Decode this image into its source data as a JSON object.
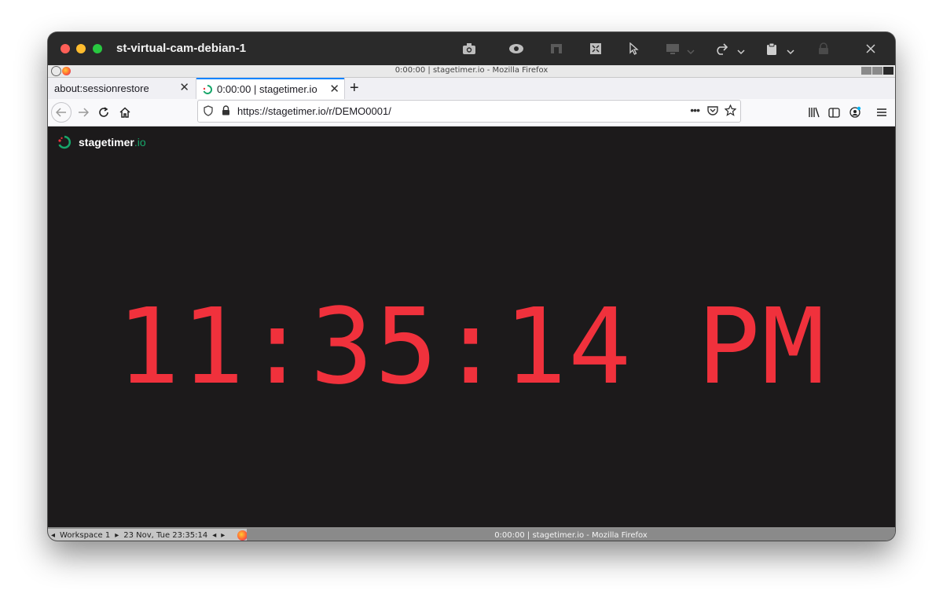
{
  "window": {
    "title": "st-virtual-cam-debian-1"
  },
  "toolbar_icons": [
    "camera-icon",
    "eye-icon",
    "dock-icon",
    "fit-icon",
    "pointer-icon",
    "display-icon",
    "redo-icon",
    "clipboard-icon",
    "lock-icon",
    "close-icon"
  ],
  "x11_bar": {
    "title": "0:00:00 | stagetimer.io - Mozilla Firefox"
  },
  "tabs": [
    {
      "label": "about:sessionrestore",
      "active": false
    },
    {
      "label": "0:00:00 | stagetimer.io",
      "active": true
    }
  ],
  "url": "https://stagetimer.io/r/DEMO0001/",
  "logo": {
    "name": "stagetimer",
    "suffix": ".io"
  },
  "clock": "11:35:14 PM",
  "statusbar": {
    "workspace": "Workspace 1",
    "datetime": "23 Nov, Tue 23:35:14",
    "task_title": "0:00:00 | stagetimer.io - Mozilla Firefox"
  },
  "colors": {
    "clock": "#f0313c",
    "accent": "#17a66a",
    "background": "#1c1a1b"
  }
}
